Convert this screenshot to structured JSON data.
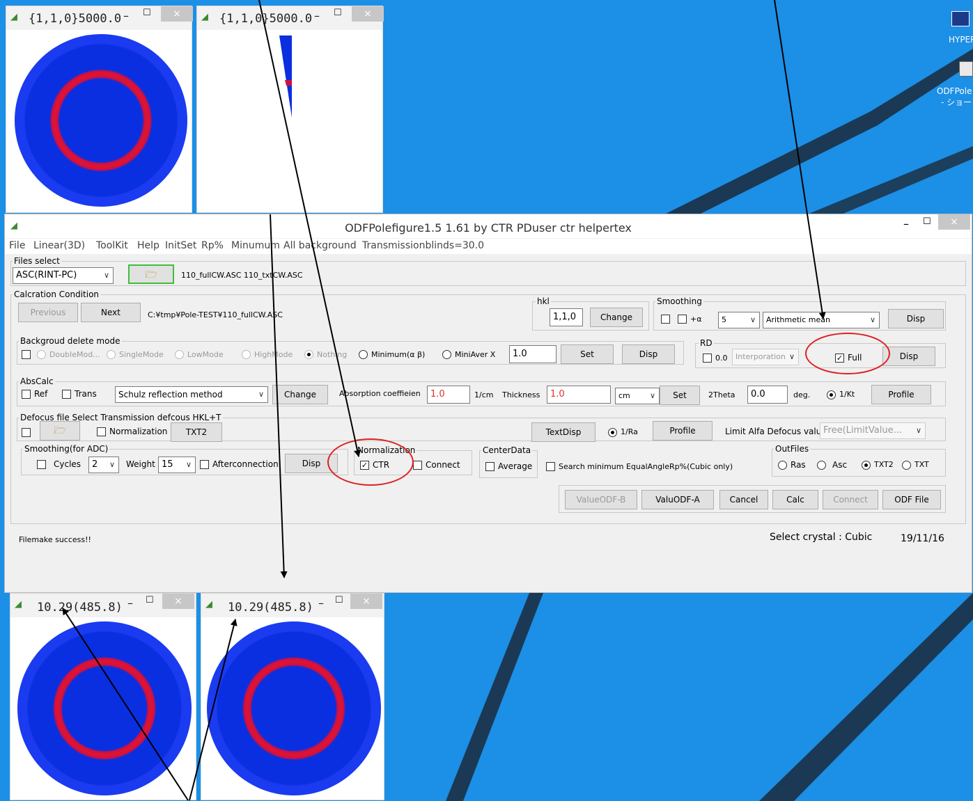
{
  "top_windows": [
    {
      "title": "{1,1,0}5000.0"
    },
    {
      "title": "{1,1,0}5000.0"
    }
  ],
  "bottom_windows": [
    {
      "title": "10.29(485.8)"
    },
    {
      "title": "10.29(485.8)"
    }
  ],
  "window_controls": {
    "minimize": "–",
    "maximize": "☐",
    "close": "×"
  },
  "desktop": {
    "icons": [
      {
        "label": "HYPER"
      },
      {
        "label": "ODFPole"
      },
      {
        "label": "- ショー"
      }
    ]
  },
  "main": {
    "title": "ODFPolefigure1.5 1.61 by CTR PDuser ctr helpertex",
    "menu": [
      "File",
      "Linear(3D)",
      "ToolKit",
      "Help",
      "InitSet",
      "Rp%",
      "Minumum",
      "All background",
      "Transmissionblinds=30.0"
    ],
    "files_select": {
      "legend": "Files select",
      "format": "ASC(RINT-PC)",
      "files": "110_fullCW.ASC 110_txtCW.ASC"
    },
    "calc": {
      "legend": "Calcration Condition",
      "previous": "Previous",
      "next": "Next",
      "path": "C:¥tmp¥Pole-TEST¥110_fullCW.ASC"
    },
    "hkl": {
      "legend": "hkl",
      "value": "1,1,0",
      "change": "Change"
    },
    "smoothing": {
      "legend": "Smoothing",
      "alpha": "+α",
      "count": "5",
      "method": "Arithmetic mean",
      "disp": "Disp"
    },
    "background": {
      "legend": "Backgroud delete mode",
      "modes": [
        "DoubleMod...",
        "SingleMode",
        "LowMode",
        "HighMode",
        "Nothing",
        "Minimum(α β)",
        "MiniAver X"
      ],
      "value": "1.0",
      "set": "Set",
      "disp": "Disp"
    },
    "rd": {
      "legend": "RD",
      "value": "0.0",
      "method": "Interporation",
      "full": "Full",
      "disp": "Disp"
    },
    "abscalc": {
      "legend": "AbsCalc",
      "ref": "Ref",
      "trans": "Trans",
      "method": "Schulz reflection method",
      "change": "Change",
      "coef_label": "Absorption coeffieien",
      "coef": "1.0",
      "coef_unit": "1/cm",
      "thick_label": "Thickness",
      "thick": "1.0",
      "thick_unit": "cm",
      "set": "Set",
      "theta_label": "2Theta",
      "theta": "0.0",
      "deg": "deg.",
      "kt": "1/Kt",
      "profile": "Profile"
    },
    "defocus": {
      "legend": "Defocus file Select Transmission defcous HKL+T",
      "normalization": "Normalization",
      "txt2": "TXT2",
      "textdisp": "TextDisp",
      "ra": "1/Ra",
      "profile": "Profile",
      "limit_label": "Limit Alfa Defocus value",
      "limit": "Free(LimitValue..."
    },
    "smoothing_adc": {
      "legend": "Smoothing(for ADC)",
      "cycles": "Cycles",
      "cycles_val": "2",
      "weight": "Weight",
      "weight_val": "15",
      "after": "Afterconnection",
      "disp": "Disp"
    },
    "normalization": {
      "legend": "Normalization",
      "ctr": "CTR",
      "connect": "Connect"
    },
    "center": {
      "legend": "CenterData",
      "average": "Average"
    },
    "search": "Search minimum EqualAngleRp%(Cubic only)",
    "outfiles": {
      "legend": "OutFiles",
      "options": [
        "Ras",
        "Asc",
        "TXT2",
        "TXT"
      ]
    },
    "actions": [
      "ValueODF-B",
      "ValuODF-A",
      "Cancel",
      "Calc",
      "Connect",
      "ODF File"
    ],
    "status": "Filemake success!!",
    "crystal": "Select crystal : Cubic",
    "date": "19/11/16"
  },
  "colors": {
    "desktop": "#1c8fe6",
    "pole_blue": "#0a2fe0",
    "ring_red": "#e01430",
    "annotation_red": "#e02020"
  }
}
